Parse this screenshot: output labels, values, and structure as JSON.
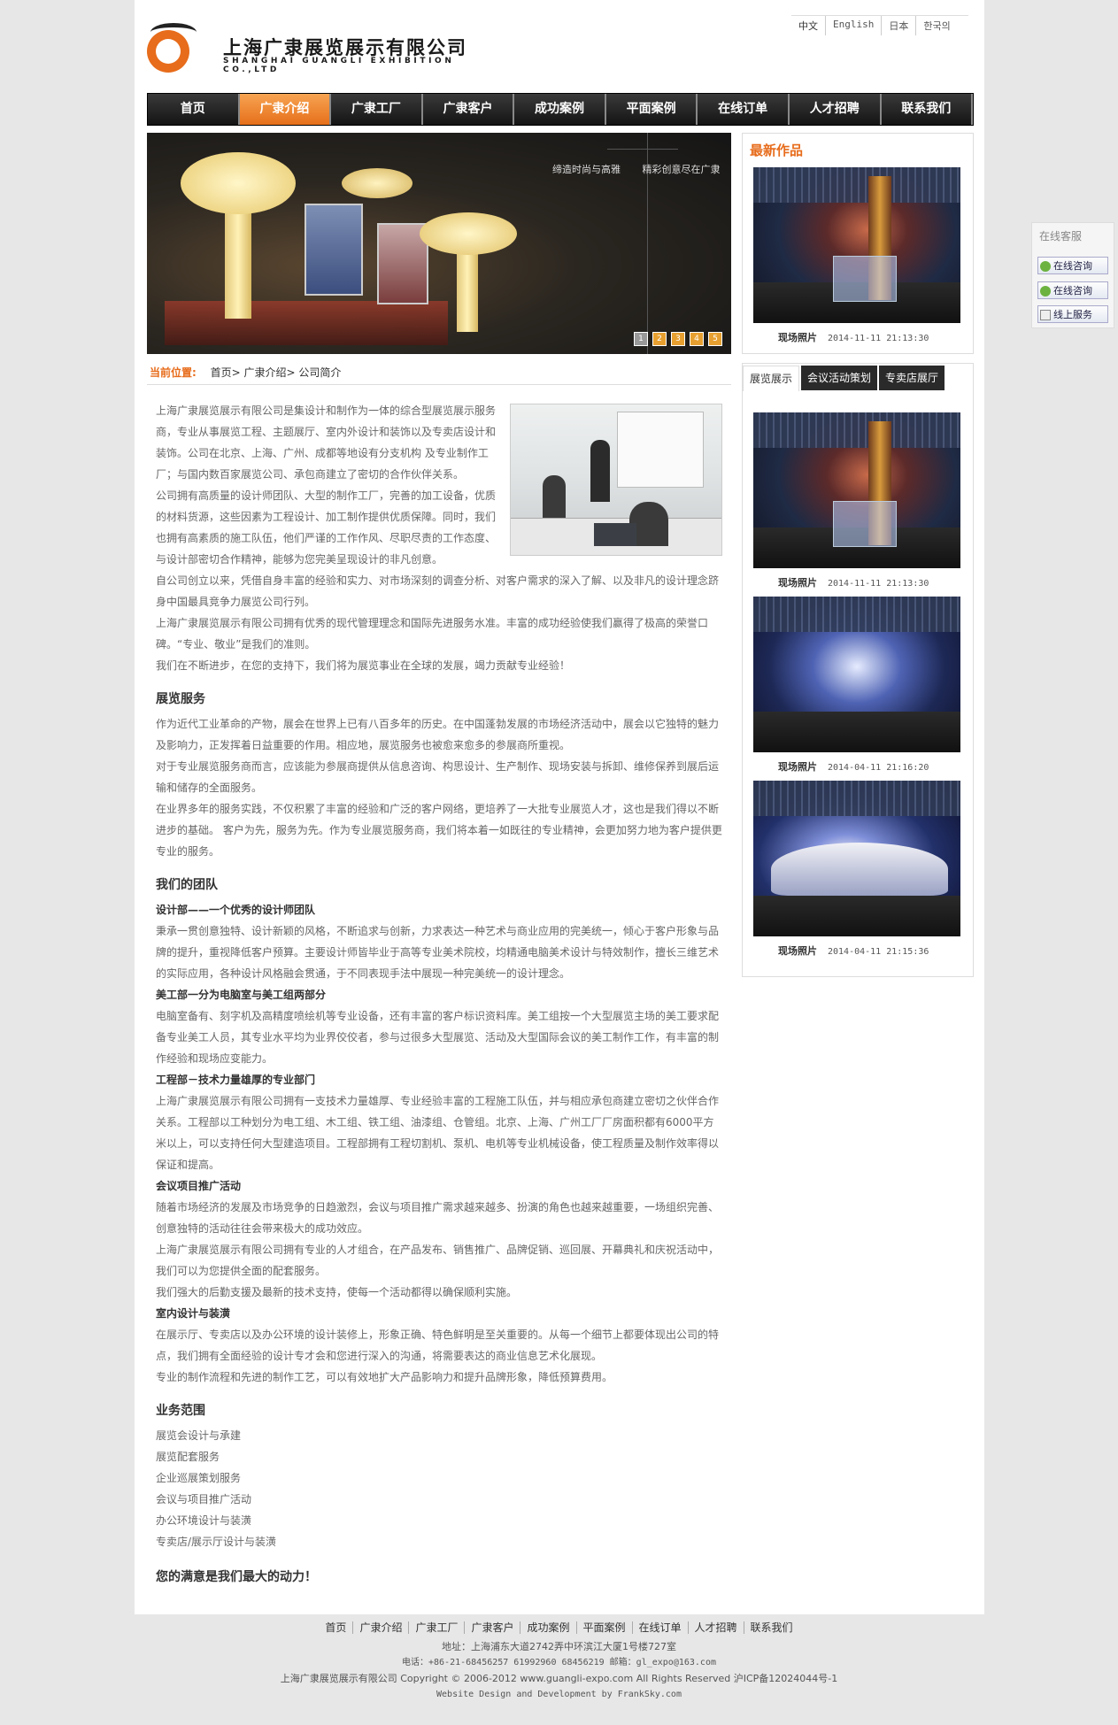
{
  "header": {
    "company_cn": "上海广隶展览展示有限公司",
    "company_en": "SHANGHAI GUANGLI EXHIBITION CO.,LTD",
    "languages": [
      "中文",
      "English",
      "日本",
      "한국의"
    ]
  },
  "nav": [
    {
      "label": "首页",
      "active": false
    },
    {
      "label": "广隶介绍",
      "active": true
    },
    {
      "label": "广隶工厂",
      "active": false
    },
    {
      "label": "广隶客户",
      "active": false
    },
    {
      "label": "成功案例",
      "active": false
    },
    {
      "label": "平面案例",
      "active": false
    },
    {
      "label": "在线订单",
      "active": false
    },
    {
      "label": "人才招聘",
      "active": false
    },
    {
      "label": "联系我们",
      "active": false
    }
  ],
  "banner": {
    "slogan1": "缔造时尚与高雅",
    "slogan2": "精彩创意尽在广隶",
    "pages": [
      "1",
      "2",
      "3",
      "4",
      "5"
    ]
  },
  "breadcrumb": {
    "label": "当前位置:",
    "path": "首页> 广隶介绍> 公司简介"
  },
  "intro": [
    "上海广隶展览展示有限公司是集设计和制作为一体的综合型展览展示服务商，专业从事展览工程、主题展厅、室内外设计和装饰以及专卖店设计和装饰。公司在北京、上海、广州、成都等地设有分支机构 及专业制作工厂；与国内数百家展览公司、承包商建立了密切的合作伙伴关系。",
    "公司拥有高质量的设计师团队、大型的制作工厂，完善的加工设备，优质的材料货源，这些因素为工程设计、加工制作提供优质保障。同时，我们也拥有高素质的施工队伍，他们严谨的工作作风、尽职尽责的工作态度、与设计部密切合作精神，能够为您完美呈现设计的非凡创意。",
    "自公司创立以来，凭借自身丰富的经验和实力、对市场深刻的调查分析、对客户需求的深入了解、以及非凡的设计理念跻身中国最具竞争力展览公司行列。",
    "上海广隶展览展示有限公司拥有优秀的现代管理理念和国际先进服务水准。丰富的成功经验使我们赢得了极高的荣誉口碑。“专业、敬业”是我们的准则。",
    "我们在不断进步，在您的支持下，我们将为展览事业在全球的发展，竭力贡献专业经验！"
  ],
  "services": {
    "title": "展览服务",
    "paragraphs": [
      "作为近代工业革命的产物，展会在世界上已有八百多年的历史。在中国蓬勃发展的市场经济活动中，展会以它独特的魅力及影响力，正发挥着日益重要的作用。相应地，展览服务也被愈来愈多的参展商所重视。",
      "对于专业展览服务商而言，应该能为参展商提供从信息咨询、构思设计、生产制作、现场安装与拆卸、维修保养到展后运输和储存的全面服务。",
      "在业界多年的服务实践，不仅积累了丰富的经验和广泛的客户网络，更培养了一大批专业展览人才，这也是我们得以不断进步的基础。 客户为先，服务为先。作为专业展览服务商，我们将本着一如既往的专业精神，会更加努力地为客户提供更专业的服务。"
    ]
  },
  "team": {
    "title": "我们的团队",
    "sections": [
      {
        "heading": "设计部——一个优秀的设计师团队",
        "paragraphs": [
          "秉承一贯创意独特、设计新颖的风格，不断追求与创新，力求表达一种艺术与商业应用的完美统一，倾心于客户形象与品牌的提升，重视降低客户预算。主要设计师皆毕业于高等专业美术院校，均精通电脑美术设计与特效制作，擅长三维艺术的实际应用，各种设计风格融会贯通，于不同表现手法中展现一种完美统一的设计理念。"
        ]
      },
      {
        "heading": "美工部一分为电脑室与美工组两部分",
        "paragraphs": [
          "电脑室备有、刻字机及高精度喷绘机等专业设备，还有丰富的客户标识资料库。美工组按一个大型展览主场的美工要求配备专业美工人员，其专业水平均为业界佼佼者，参与过很多大型展览、活动及大型国际会议的美工制作工作，有丰富的制作经验和现场应变能力。"
        ]
      },
      {
        "heading": "工程部－技术力量雄厚的专业部门",
        "paragraphs": [
          "上海广隶展览展示有限公司拥有一支技术力量雄厚、专业经验丰富的工程施工队伍，并与相应承包商建立密切之伙伴合作关系。工程部以工种划分为电工组、木工组、铁工组、油漆组、仓管组。北京、上海、广州工厂厂房面积都有6000平方米以上，可以支持任何大型建造项目。工程部拥有工程切割机、泵机、电机等专业机械设备，使工程质量及制作效率得以保证和提高。"
        ]
      },
      {
        "heading": "会议项目推广活动",
        "paragraphs": [
          "随着市场经济的发展及市场竞争的日趋激烈，会议与项目推广需求越来越多、扮演的角色也越来越重要，一场组织完善、创意独特的活动往往会带来极大的成功效应。",
          "上海广隶展览展示有限公司拥有专业的人才组合，在产品发布、销售推广、品牌促销、巡回展、开幕典礼和庆祝活动中，我们可以为您提供全面的配套服务。",
          "我们强大的后勤支援及最新的技术支持，使每一个活动都得以确保顺利实施。"
        ]
      },
      {
        "heading": "室内设计与装潢",
        "paragraphs": [
          "在展示厅、专卖店以及办公环境的设计装修上，形象正确、特色鲜明是至关重要的。从每一个细节上都要体现出公司的特点，我们拥有全面经验的设计专才会和您进行深入的沟通，将需要表达的商业信息艺术化展现。",
          "专业的制作流程和先进的制作工艺，可以有效地扩大产品影响力和提升品牌形象，降低预算费用。"
        ]
      }
    ]
  },
  "scope": {
    "title": "业务范围",
    "items": [
      "展览会设计与承建",
      "展览配套服务",
      "企业巡展策划服务",
      "会议与项目推广活动",
      "办公环境设计与装潢",
      "专卖店/展示厅设计与装潢"
    ]
  },
  "slogan": "您的满意是我们最大的动力！",
  "sidebar": {
    "latest_title": "最新作品",
    "latest": {
      "caption": "现场照片",
      "date": "2014-11-11 21:13:30"
    },
    "tabs": [
      "展览展示",
      "会议活动策划",
      "专卖店展厅"
    ],
    "gallery": [
      {
        "caption": "现场照片",
        "date": "2014-11-11 21:13:30"
      },
      {
        "caption": "现场照片",
        "date": "2014-04-11 21:16:20"
      },
      {
        "caption": "现场照片",
        "date": "2014-04-11 21:15:36"
      }
    ]
  },
  "float_service": {
    "title": "在线客服",
    "buttons": [
      "在线咨询",
      "在线咨询",
      "线上服务"
    ]
  },
  "footer": {
    "links": [
      "首页",
      "广隶介绍",
      "广隶工厂",
      "广隶客户",
      "成功案例",
      "平面案例",
      "在线订单",
      "人才招聘",
      "联系我们"
    ],
    "address": "地址：上海浦东大道2742弄中环滨江大厦1号楼727室",
    "phone": "电话：+86-21-68456257  61992960  68456219    邮箱：gl_expo@163.com",
    "copyright": "上海广隶展览展示有限公司 Copyright © 2006-2012 www.guangli-expo.com All Rights Reserved  沪ICP备12024044号-1",
    "credit": "Website Design and Development by FrankSky.com"
  }
}
